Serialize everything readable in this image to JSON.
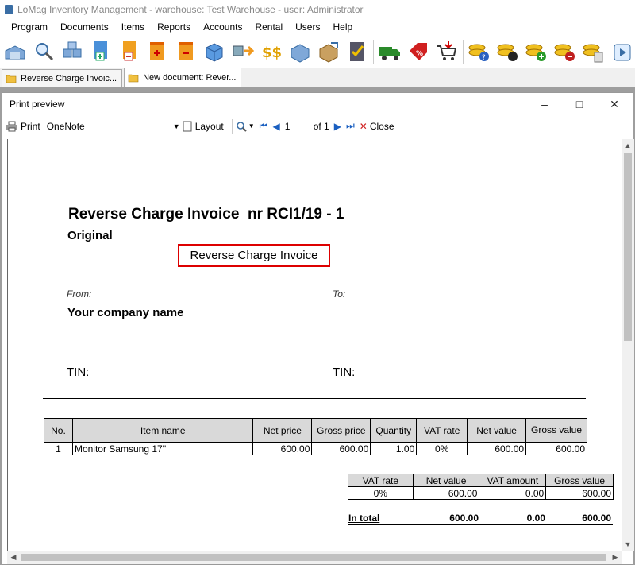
{
  "app": {
    "title": "LoMag Inventory Management - warehouse: Test Warehouse - user: Administrator"
  },
  "menu": [
    "Program",
    "Documents",
    "Items",
    "Reports",
    "Accounts",
    "Rental",
    "Users",
    "Help"
  ],
  "tabs": [
    {
      "label": "Reverse Charge Invoic..."
    },
    {
      "label": "New document: Rever..."
    }
  ],
  "preview_window": {
    "title": "Print preview",
    "print_label": "Print",
    "printer": "OneNote",
    "layout_label": "Layout",
    "page_current": "1",
    "page_of": "of 1",
    "close_label": "Close"
  },
  "document": {
    "title": "Reverse Charge Invoice  nr RCI1/19 - 1",
    "copy_label": "Original",
    "doc_type": "Reverse Charge Invoice",
    "from_label": "From:",
    "to_label": "To:",
    "seller_name": "Your company name",
    "tin_label_seller": "TIN:",
    "tin_label_buyer": "TIN:",
    "items_headers": [
      "No.",
      "Item name",
      "Net price",
      "Gross price",
      "Quantity",
      "VAT rate",
      "Net value",
      "Gross value"
    ],
    "items": [
      {
        "no": "1",
        "name": "Monitor Samsung 17''",
        "net_price": "600.00",
        "gross_price": "600.00",
        "quantity": "1.00",
        "vat_rate": "0%",
        "net_value": "600.00",
        "gross_value": "600.00"
      }
    ],
    "vat_headers": [
      "VAT rate",
      "Net value",
      "VAT amount",
      "Gross value"
    ],
    "vat_rows": [
      {
        "rate": "0%",
        "net": "600.00",
        "vat": "0.00",
        "gross": "600.00"
      }
    ],
    "total": {
      "label": "In total",
      "net": "600.00",
      "vat": "0.00",
      "gross": "600.00"
    }
  }
}
